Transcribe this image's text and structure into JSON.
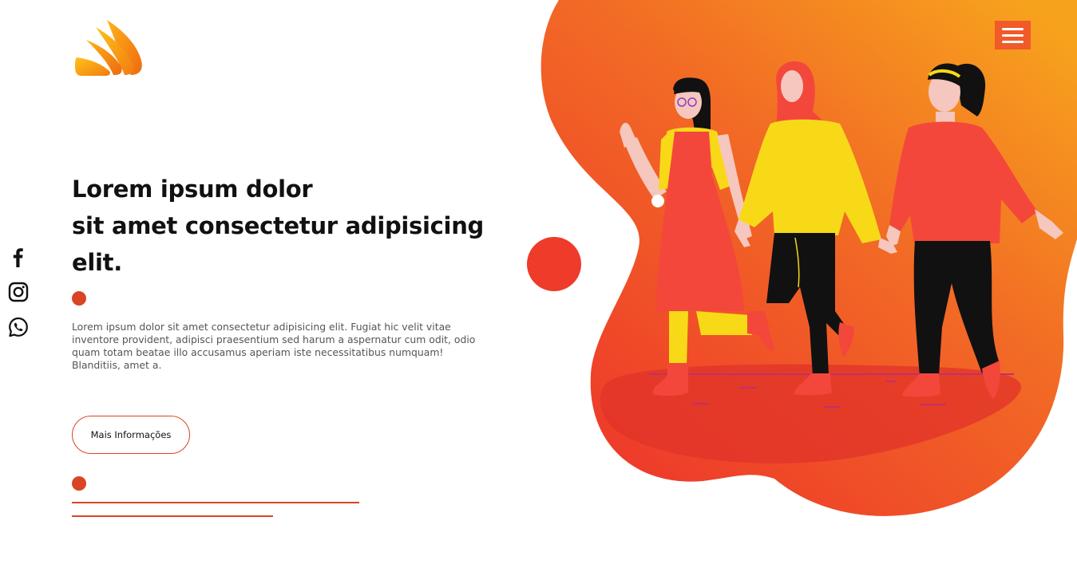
{
  "hero": {
    "title_lines": [
      "Lorem ipsum dolor",
      "sit amet consectetur adipisicing",
      "elit."
    ],
    "description": "Lorem ipsum dolor sit amet consectetur adipisicing elit. Fugiat hic velit vitae inventore provident, adipisci praesentium sed harum a aspernatur cum odit, odio quam totam beatae illo accusamus aperiam iste necessitatibus numquam! Blanditiis, amet a.",
    "button_label": "Mais Informações"
  },
  "social": {
    "items": [
      "facebook-icon",
      "instagram-icon",
      "whatsapp-icon"
    ]
  },
  "menu": {
    "icon": "hamburger-menu-icon"
  },
  "colors": {
    "accent": "#d94524",
    "menu_bg": "#f15a29",
    "blob_top": "#f7a21d",
    "blob_bottom": "#ee3b2a"
  }
}
